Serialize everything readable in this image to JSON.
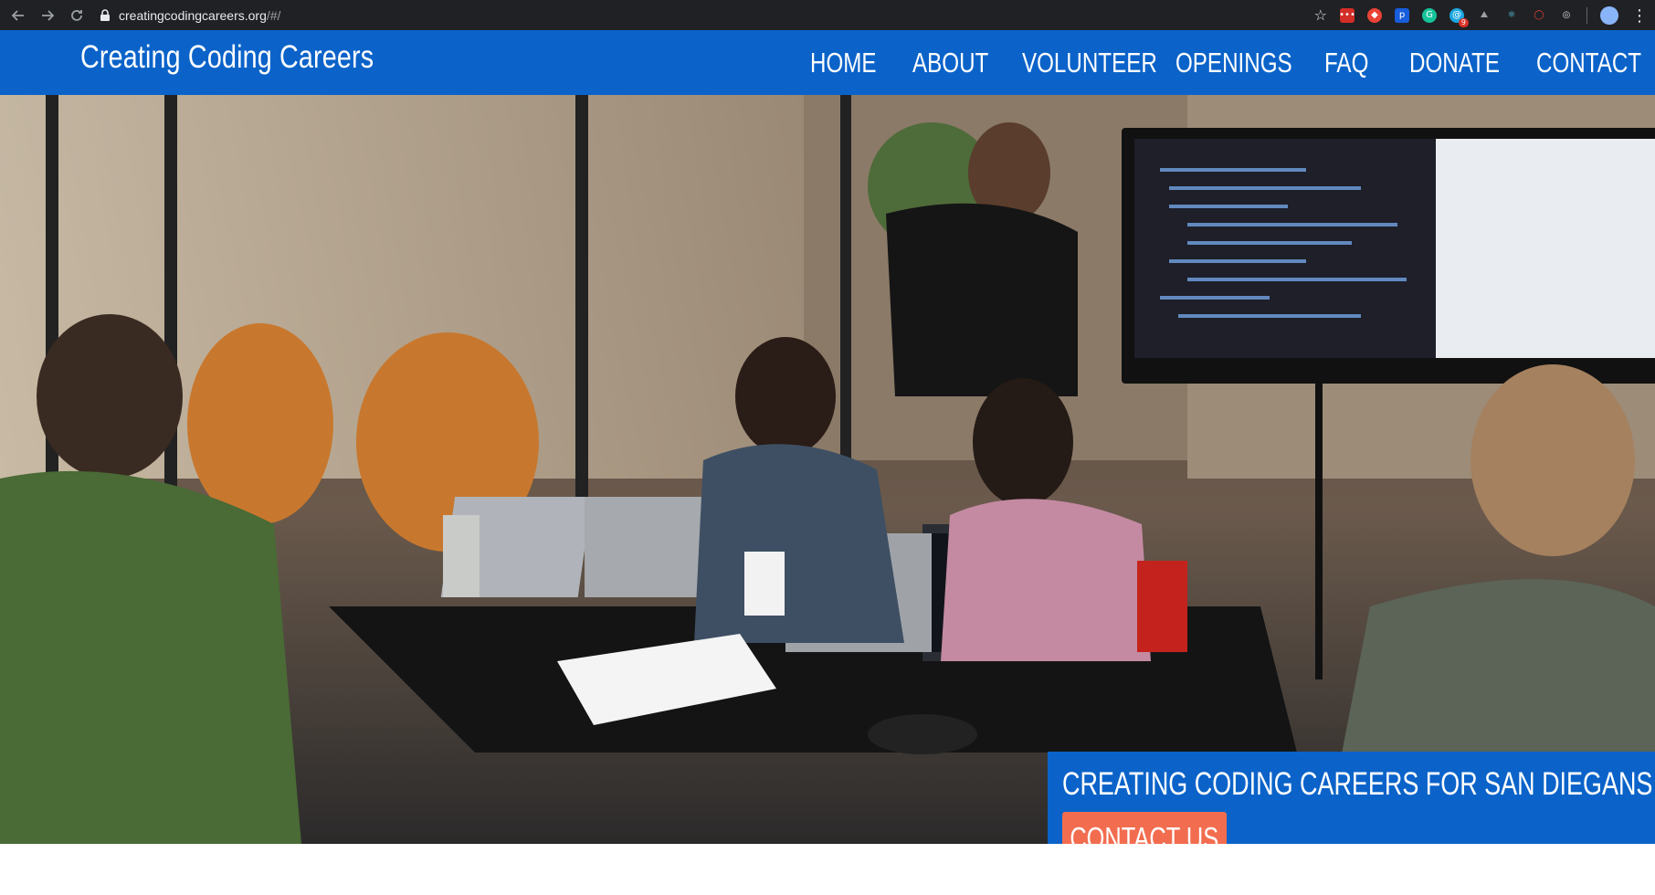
{
  "browser": {
    "url_host": "creatingcodingcareers.org",
    "url_path": "/#/",
    "back_icon": "arrow-left-icon",
    "forward_icon": "arrow-right-icon",
    "reload_icon": "reload-icon",
    "star_icon": "star-icon",
    "extensions": [
      {
        "name": "lastpass-icon",
        "color": "#d32d27"
      },
      {
        "name": "bitwarden-icon",
        "color": "#175ddc"
      },
      {
        "name": "grammarly-icon",
        "color": "#15c39a"
      },
      {
        "name": "extension-icon",
        "color": "#1ba7e0"
      },
      {
        "name": "react-devtools-icon",
        "color": "#61dafb"
      },
      {
        "name": "record-icon",
        "color": "#ea4335"
      },
      {
        "name": "target-icon",
        "color": "#dadce0"
      }
    ],
    "extension_badge": "9",
    "menu_icon": "kebab-menu-icon"
  },
  "site": {
    "brand": "Creating Coding Careers",
    "nav": [
      {
        "label": "HOME"
      },
      {
        "label": "ABOUT"
      },
      {
        "label": "VOLUNTEER"
      },
      {
        "label": "OPENINGS"
      },
      {
        "label": "FAQ"
      },
      {
        "label": "DONATE"
      },
      {
        "label": "CONTACT"
      }
    ]
  },
  "hero": {
    "heading": "CREATING CODING CAREERS FOR SAN DIEGANS",
    "cta_label": "CONTACT US"
  },
  "colors": {
    "brand_blue": "#0b63c9",
    "cta_orange": "#f26d4f",
    "chrome_bg": "#202124"
  }
}
